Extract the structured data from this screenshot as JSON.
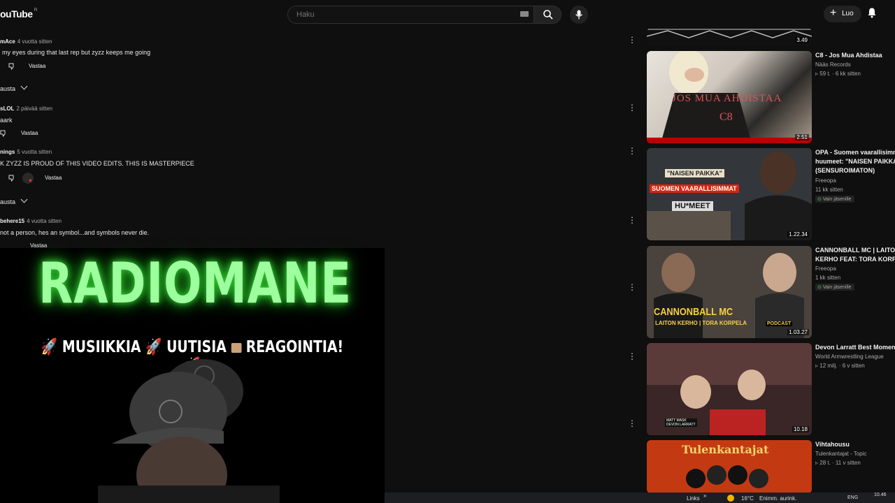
{
  "header": {
    "logo_text": "ouTube",
    "logo_country": "FI",
    "search_placeholder": "Haku",
    "create_label": "Luo"
  },
  "comments": [
    {
      "author": "mAce",
      "time": "4 vuotta sitten",
      "text": "my eyes during that last rep but zyzz keeps me going",
      "reply": "Vastaa"
    },
    {
      "expand": "austa"
    },
    {
      "author": "sLOL",
      "time": "2 päivää sitten",
      "text": "aark",
      "reply": "Vastaa"
    },
    {
      "author": "nings",
      "time": "5 vuotta sitten",
      "text": "K ZYZZ IS PROUD OF THIS VIDEO EDITS. THIS IS MASTERPIECE",
      "reply": "Vastaa"
    },
    {
      "expand": "austa"
    },
    {
      "author": "behere15",
      "time": "4 vuotta sitten",
      "text": "not a person, hes an symbol...and symbols never die.",
      "reply": "Vastaa"
    }
  ],
  "overlay": {
    "title": "RADIOMANE",
    "sub1": "MUSIIKKIA",
    "sub2": "UUTISIA",
    "sub3": "REAGOINTIA!"
  },
  "videos": [
    {
      "title": "",
      "channel": "",
      "meta": "",
      "duration": "3.49"
    },
    {
      "title": "C8 - Jos Mua Ahdistaa",
      "channel": "Nääs Records",
      "meta": "59 t. · 6 kk sitten",
      "duration": "2.51",
      "badge": ""
    },
    {
      "title": "OPA - Suomen vaarallisimmat",
      "title2": "huumeet: \"NAISEN PAIKKA\"",
      "title3": "(SENSUROIMATON)",
      "channel": "Freeopa",
      "meta": "11 kk sitten",
      "badge": "Vain jäsenille",
      "duration": "1.22.34"
    },
    {
      "title": "CANNONBALL MC | LAITON",
      "title2": "KERHO FEAT: TORA KORPELA",
      "channel": "Freeopa",
      "meta": "1 kk sitten",
      "badge": "Vain jäsenille",
      "duration": "1.03.27"
    },
    {
      "title": "Devon Larratt Best Moments",
      "channel": "World Armwrestling League",
      "meta": "12 milj. · 6 v sitten",
      "duration": "10.18"
    },
    {
      "title": "Vihtahousu",
      "channel": "Tulenkantajat - Topic",
      "meta": "28 t. · 11 v sitten",
      "duration": ""
    }
  ],
  "thumb_text": {
    "v1_text": "JOS MUA AHDISTAA",
    "v1_sub": "C8",
    "v2_top": "\"NAISEN PAIKKA\"",
    "v2_mid": "SUOMEN VAARALLISIMMAT",
    "v2_bot": "HU*MEET",
    "v3_big": "CANNONBALL MC",
    "v3_small": "LAITON KERHO | TORA KORPELA",
    "v3_pod": "PODCAST",
    "v4_name1": "MATT MASK",
    "v4_name2": "DEVON LARRATT",
    "v5_text": "Tulenkantajat"
  },
  "taskbar": {
    "weather": "16°C",
    "weather_desc": "Enimm. aurink.",
    "lang": "ENG",
    "time": "10.46",
    "links": "Links"
  },
  "colors": {
    "accent_green": "#9dff9d",
    "badge_green": "#3c9b3c",
    "bg": "#0f0f0f"
  }
}
